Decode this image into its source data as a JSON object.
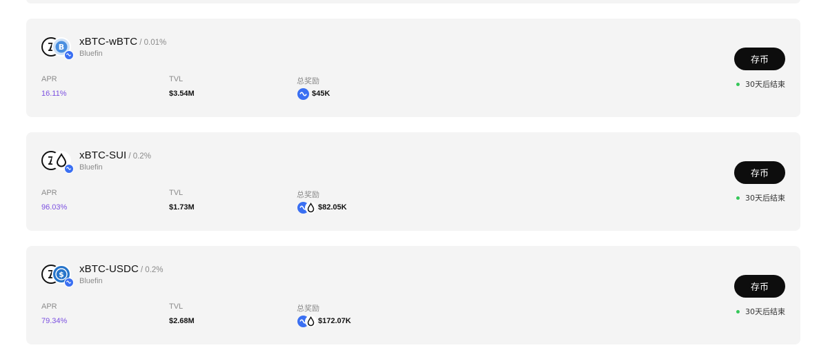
{
  "labels": {
    "apr": "APR",
    "tvl": "TVL",
    "rewards": "总奖励"
  },
  "colors": {
    "apr_value": "#7b4fe0",
    "status_dot": "#35c759",
    "protocol_badge": "#3a6ff2",
    "button": "#0d0d0d"
  },
  "pools": [
    {
      "name": "xBTC-wBTC",
      "fee": "/ 0.01%",
      "platform": "Bluefin",
      "token_icons": [
        "xbtc-icon",
        "wbtc-icon",
        "bluefin-badge-icon"
      ],
      "apr": "16.11%",
      "tvl": "$3.54M",
      "reward_icons": [
        "bluefin-reward-icon"
      ],
      "rewards": "$45K",
      "button": "存币",
      "status": "30天后结束"
    },
    {
      "name": "xBTC-SUI",
      "fee": "/ 0.2%",
      "platform": "Bluefin",
      "token_icons": [
        "xbtc-icon",
        "sui-icon",
        "bluefin-badge-icon"
      ],
      "apr": "96.03%",
      "tvl": "$1.73M",
      "reward_icons": [
        "bluefin-reward-icon",
        "sui-reward-icon"
      ],
      "rewards": "$82.05K",
      "button": "存币",
      "status": "30天后结束"
    },
    {
      "name": "xBTC-USDC",
      "fee": "/ 0.2%",
      "platform": "Bluefin",
      "token_icons": [
        "xbtc-icon",
        "usdc-icon",
        "bluefin-badge-icon"
      ],
      "apr": "79.34%",
      "tvl": "$2.68M",
      "reward_icons": [
        "bluefin-reward-icon",
        "sui-reward-icon"
      ],
      "rewards": "$172.07K",
      "button": "存币",
      "status": "30天后结束"
    }
  ]
}
